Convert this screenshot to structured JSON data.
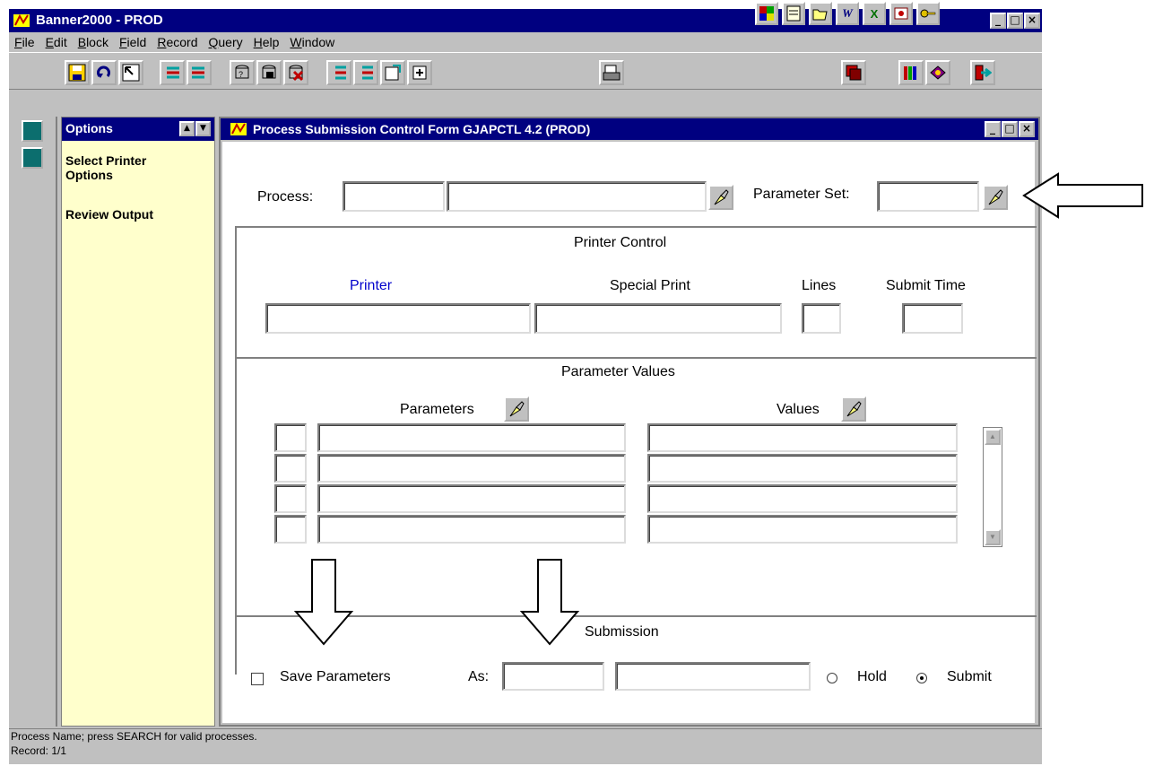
{
  "app": {
    "title": "Banner2000 - PROD",
    "accent": "#000080",
    "tray_icons": [
      "color-icon",
      "notepad-icon",
      "folder-open-icon",
      "word-icon",
      "excel-icon",
      "powerpoint-icon",
      "key-icon"
    ],
    "tray_letters": [
      "",
      "",
      "",
      "W",
      "X",
      "",
      ""
    ]
  },
  "menu": [
    "File",
    "Edit",
    "Block",
    "Field",
    "Record",
    "Query",
    "Help",
    "Window"
  ],
  "options_panel": {
    "title": "Options",
    "items": [
      "Select Printer Options",
      "Review Output"
    ],
    "background": "#ffffcc"
  },
  "form": {
    "title": "Process Submission Control Form  GJAPCTL  4.2  (PROD)",
    "process_label": "Process:",
    "parameter_set_label": "Parameter Set:",
    "printer_control": {
      "section_title": "Printer Control",
      "printer_label": "Printer",
      "special_print_label": "Special Print",
      "lines_label": "Lines",
      "submit_time_label": "Submit Time"
    },
    "parameter_values": {
      "section_title": "Parameter Values",
      "parameters_label": "Parameters",
      "values_label": "Values"
    },
    "submission": {
      "section_title": "Submission",
      "save_parameters_label": "Save Parameters",
      "as_label": "As:",
      "hold_label": "Hold",
      "submit_label": "Submit",
      "selected": "Submit"
    }
  },
  "status": {
    "message": "Process Name; press SEARCH for valid processes.",
    "record": "Record: 1/1"
  }
}
